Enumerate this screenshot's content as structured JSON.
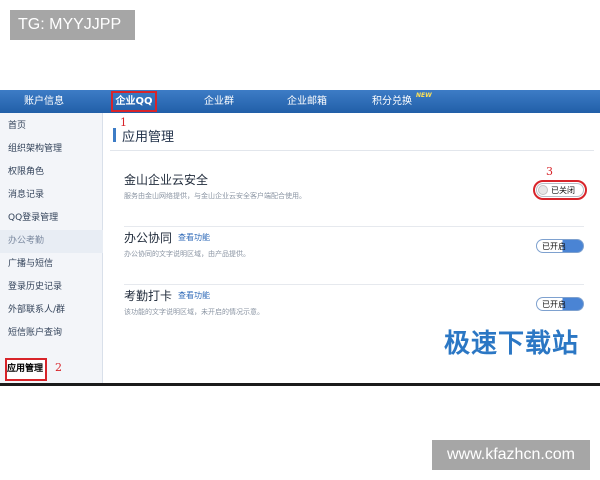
{
  "watermark_top": "TG: MYYJJPP",
  "watermark_bottom": "www.kfazhcn.com",
  "topnav": {
    "items": [
      "账户信息",
      "企业QQ",
      "企业群",
      "企业邮箱",
      "积分兑换"
    ],
    "new_badge": "NEW"
  },
  "sidebar": {
    "items": [
      "首页",
      "组织架构管理",
      "权限角色",
      "消息记录",
      "QQ登录管理",
      "办公考勤",
      "广播与短信",
      "登录历史记录",
      "外部联系人/群",
      "短信账户查询",
      "应用管理"
    ]
  },
  "annotations": [
    "1",
    "2",
    "3"
  ],
  "main": {
    "title": "应用管理",
    "apps": [
      {
        "name": "金山企业云安全",
        "link": "",
        "desc": "服务由金山网络提供，与金山企业云安全客户端配合使用。",
        "status": "已关闭"
      },
      {
        "name": "办公协同",
        "link": "查看功能",
        "desc": "办公协同的文字说明区域，由产品提供。",
        "status": "已开启"
      },
      {
        "name": "考勤打卡",
        "link": "查看功能",
        "desc": "该功能的文字说明区域，未开启的情况示意。",
        "status": "已开启"
      }
    ],
    "logo": "极速下载站"
  },
  "colors": {
    "accent": "#2f6ab8",
    "highlight": "#d8242a",
    "nav": "#2a68b0"
  }
}
